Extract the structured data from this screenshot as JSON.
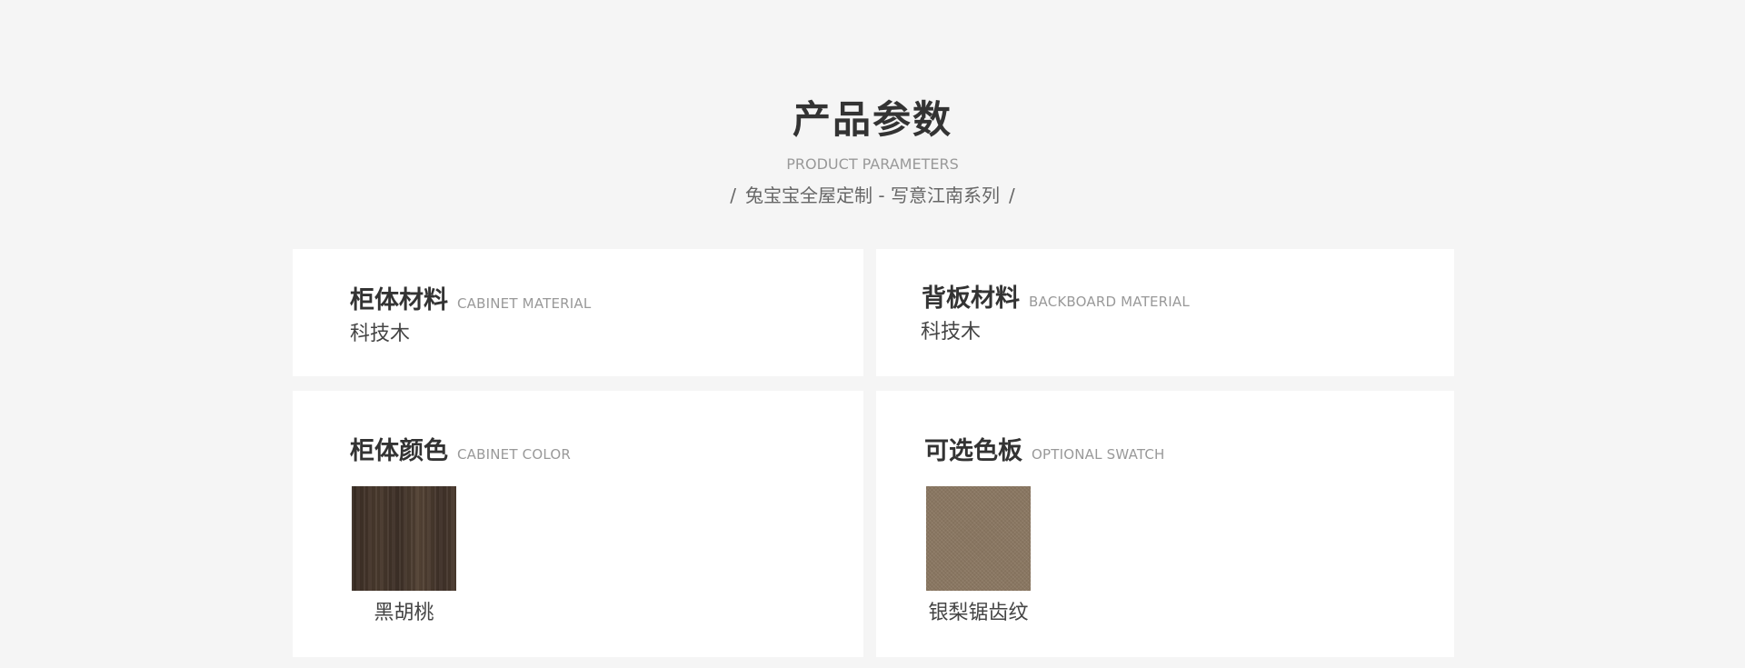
{
  "header": {
    "title": "产品参数",
    "subtitle_en": "PRODUCT PARAMETERS",
    "series": "兔宝宝全屋定制 - 写意江南系列",
    "slash_left": "/",
    "slash_right": "/"
  },
  "params": {
    "cabinet_material": {
      "title": "柜体材料",
      "title_en": "CABINET MATERIAL",
      "value": "科技木"
    },
    "backboard_material": {
      "title": "背板材料",
      "title_en": "BACKBOARD MATERIAL",
      "value": "科技木"
    },
    "cabinet_color": {
      "title": "柜体颜色",
      "title_en": "CABINET COLOR",
      "swatch_label": "黑胡桃",
      "swatch_color": "#45362b"
    },
    "optional_swatch": {
      "title": "可选色板",
      "title_en": "OPTIONAL SWATCH",
      "swatch_label": "银梨锯齿纹",
      "swatch_color": "#8d7a64"
    }
  },
  "colors": {
    "page_background": "#f5f5f5",
    "card_background": "#ffffff",
    "title_text": "#333333",
    "muted_text": "#999999"
  }
}
